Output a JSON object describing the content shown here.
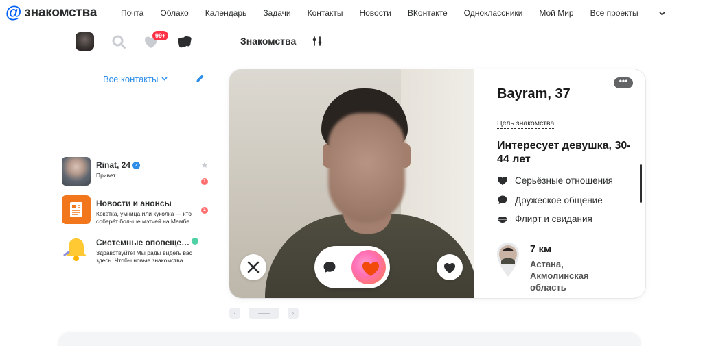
{
  "logo": {
    "at": "@",
    "text": "знакомства"
  },
  "nav": [
    "Почта",
    "Облако",
    "Календарь",
    "Задачи",
    "Контакты",
    "Новости",
    "ВКонтакте",
    "Одноклассники",
    "Мой Мир",
    "Все проекты"
  ],
  "toolbar": {
    "badge": "99+",
    "section_title": "Знакомства"
  },
  "contacts": {
    "filter_label": "Все контакты"
  },
  "chats": [
    {
      "name": "Rinat, 24",
      "preview": "Привет",
      "unread": "1"
    },
    {
      "name": "Новости и анонсы",
      "preview": "Кокетка, умница или куколка — кто соберёт больше мэтчей на Мамбе…",
      "unread": "1"
    },
    {
      "name": "Системные оповеще…",
      "preview": "Здравствуйте! Мы рады видеть вас здесь. Чтобы новые знакомства…"
    }
  ],
  "profile": {
    "name": "Bayram, 37",
    "goal_label": "Цель знакомства",
    "goal": "Интересует девушка, 30-44 лет",
    "preferences": [
      "Серьёзные отношения",
      "Дружеское общение",
      "Флирт и свидания"
    ],
    "distance": "7 км",
    "city": "Астана, Акмолинская область",
    "more": "•••"
  },
  "pager": {
    "prev": "‹",
    "next": "›"
  },
  "colors": {
    "accent": "#005ff9",
    "link": "#2b8de8",
    "badge": "#ff3347",
    "online": "#4fd1a5"
  }
}
